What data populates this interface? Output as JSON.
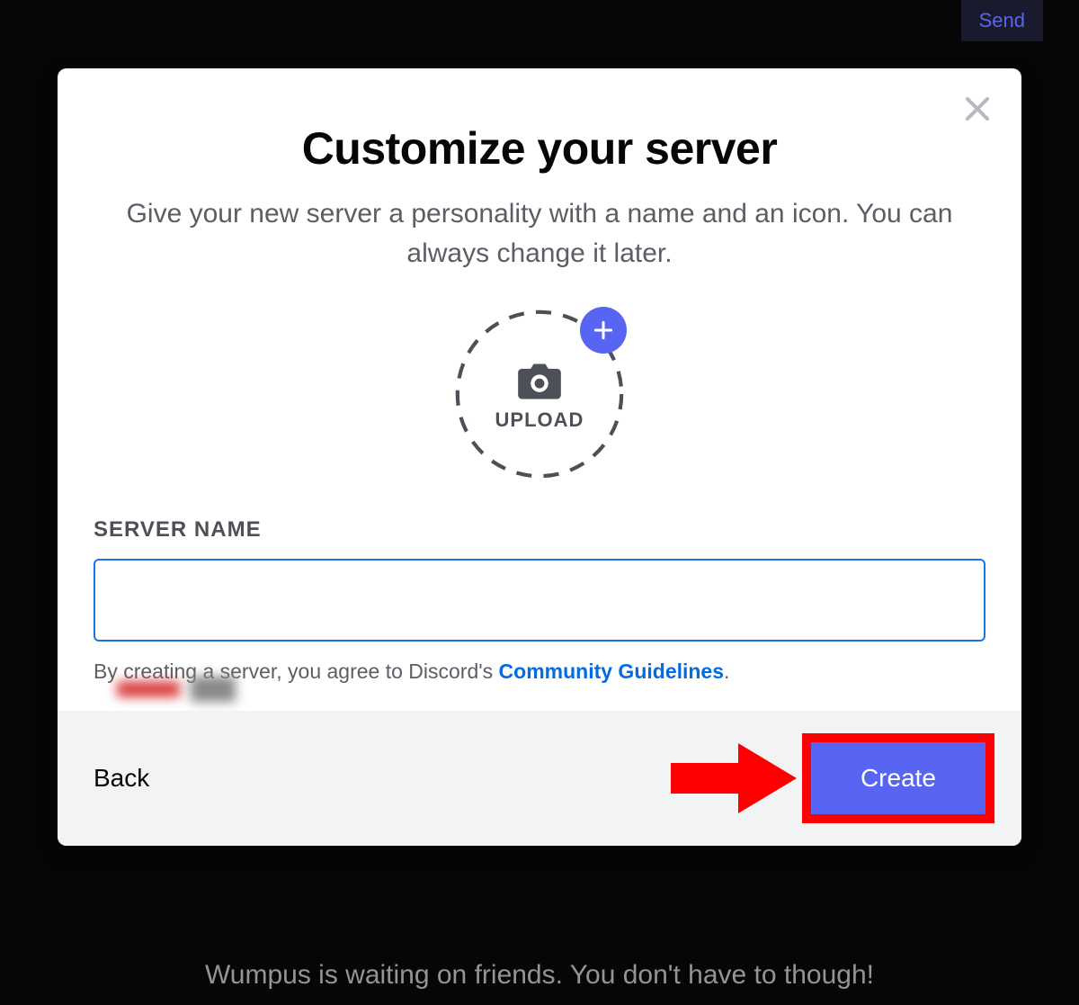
{
  "background": {
    "send_button_label": "Send",
    "bottom_text": "Wumpus is waiting on friends. You don't have to though!"
  },
  "modal": {
    "title": "Customize your server",
    "subtitle": "Give your new server a personality with a name and an icon. You can always change it later.",
    "upload_label": "UPLOAD",
    "server_name_label": "SERVER NAME",
    "server_name_value": "",
    "agreement_prefix": "By creating a server, you agree to Discord's ",
    "agreement_link": "Community Guidelines",
    "agreement_suffix": ".",
    "back_label": "Back",
    "create_label": "Create"
  },
  "colors": {
    "accent": "#5865f2",
    "link": "#006ce7",
    "highlight": "#ff0000"
  }
}
